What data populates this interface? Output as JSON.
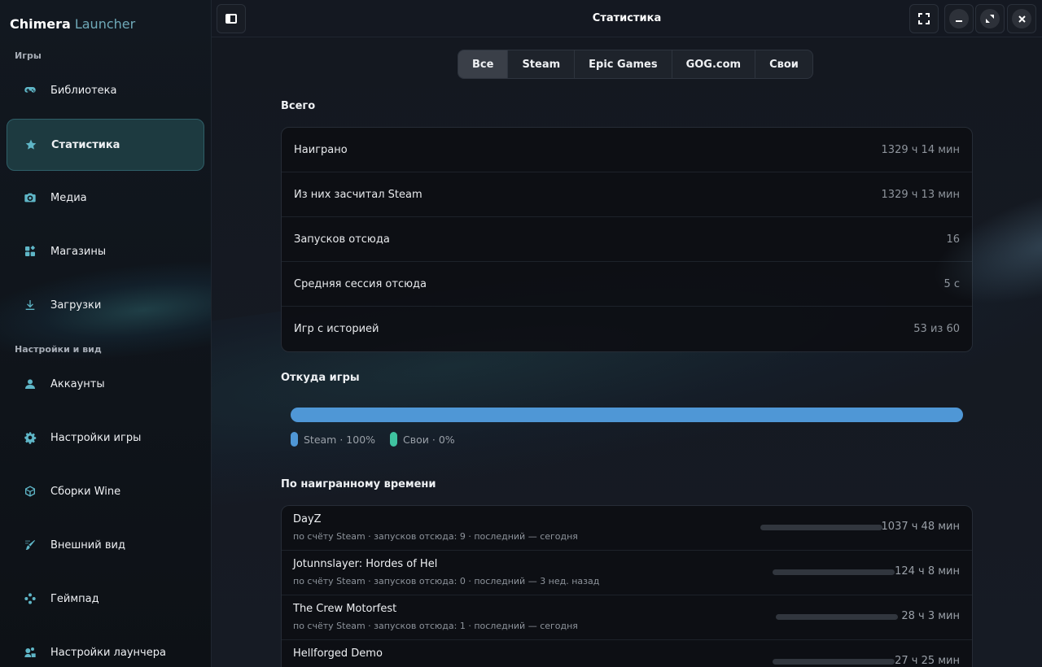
{
  "app": {
    "name": "Chimera",
    "name_suffix": "Launcher"
  },
  "sidebar": {
    "sections": [
      {
        "label": "Игры"
      },
      {
        "label": "Настройки и вид"
      }
    ],
    "items": [
      {
        "label": "Библиотека",
        "icon": "gamepad-icon"
      },
      {
        "label": "Статистика",
        "icon": "star-icon",
        "active": true
      },
      {
        "label": "Медиа",
        "icon": "camera-icon"
      },
      {
        "label": "Магазины",
        "icon": "apps-icon"
      },
      {
        "label": "Загрузки",
        "icon": "download-icon"
      },
      {
        "label": "Аккаунты",
        "icon": "person-icon"
      },
      {
        "label": "Настройки игры",
        "icon": "gear-icon"
      },
      {
        "label": "Сборки Wine",
        "icon": "cube-icon"
      },
      {
        "label": "Внешний вид",
        "icon": "brush-icon"
      },
      {
        "label": "Геймпад",
        "icon": "dpad-icon"
      },
      {
        "label": "Настройки лаунчера",
        "icon": "settings-group-icon"
      }
    ]
  },
  "header": {
    "title": "Статистика",
    "buttons": {
      "fullscreen": "fullscreen-icon",
      "minimize": "minimize-icon",
      "maximize": "maximize-icon",
      "close": "close-icon"
    }
  },
  "tabs": [
    {
      "label": "Все",
      "active": true
    },
    {
      "label": "Steam"
    },
    {
      "label": "Epic Games"
    },
    {
      "label": "GOG.com"
    },
    {
      "label": "Свои"
    }
  ],
  "totals": {
    "title": "Всего",
    "rows": [
      {
        "label": "Наиграно",
        "value": "1329 ч 14 мин"
      },
      {
        "label": "Из них засчитал Steam",
        "value": "1329 ч 13 мин"
      },
      {
        "label": "Запусков отсюда",
        "value": "16"
      },
      {
        "label": "Средняя сессия отсюда",
        "value": "5 с"
      },
      {
        "label": "Игр с историей",
        "value": "53 из 60"
      }
    ]
  },
  "sources": {
    "title": "Откуда игры",
    "segments": [
      {
        "label": "Steam · 100%",
        "share": 1.0,
        "color": "#4f97d6"
      },
      {
        "label": "Свои · 0%",
        "share": 0.0,
        "color": "#3fc3a0"
      }
    ]
  },
  "playtime": {
    "title": "По наигранному времени",
    "games": [
      {
        "name": "DayZ",
        "meta": "по счёту Steam · запусков отсюда: 9 · последний — сегодня",
        "time": "1037 ч 48 мин",
        "share": 1.0
      },
      {
        "name": "Jotunnslayer: Hordes of Hel",
        "meta": "по счёту Steam · запусков отсюда: 0 · последний — 3 нед. назад",
        "time": "124 ч 8 мин",
        "share": 0.12
      },
      {
        "name": "The Crew Motorfest",
        "meta": "по счёту Steam · запусков отсюда: 1 · последний — сегодня",
        "time": "28 ч 3 мин",
        "share": 0.03
      },
      {
        "name": "Hellforged Demo",
        "meta": "",
        "time": "27 ч 25 мин",
        "share": 0.03
      }
    ]
  }
}
